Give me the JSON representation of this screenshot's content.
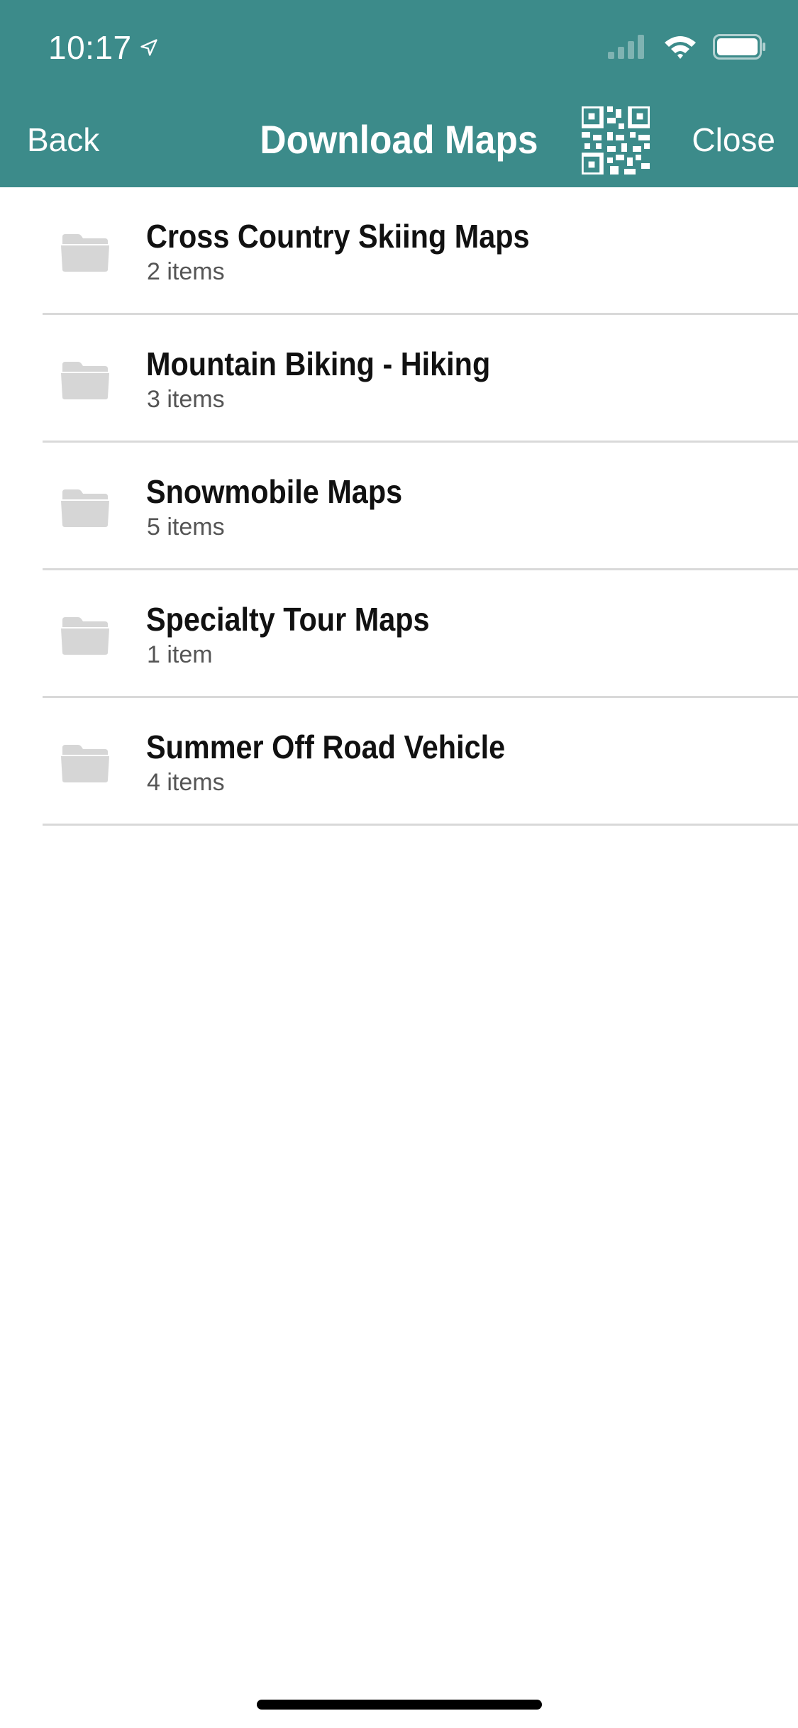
{
  "status_bar": {
    "time": "10:17",
    "location_icon": "location-arrow-icon",
    "signal_icon": "cellular-signal-icon",
    "wifi_icon": "wifi-icon",
    "battery_icon": "battery-icon"
  },
  "nav": {
    "back_label": "Back",
    "title": "Download Maps",
    "qr_icon": "qr-code-icon",
    "close_label": "Close"
  },
  "colors": {
    "header_bg": "#3c8b8a",
    "folder_icon": "#d6d6d6",
    "divider": "#d9d9d9"
  },
  "folders": [
    {
      "title": "Cross Country Skiing Maps",
      "count": "2 items"
    },
    {
      "title": "Mountain Biking - Hiking",
      "count": "3 items"
    },
    {
      "title": "Snowmobile Maps",
      "count": "5 items"
    },
    {
      "title": "Specialty Tour Maps",
      "count": "1 item"
    },
    {
      "title": "Summer Off Road Vehicle",
      "count": "4 items"
    }
  ]
}
